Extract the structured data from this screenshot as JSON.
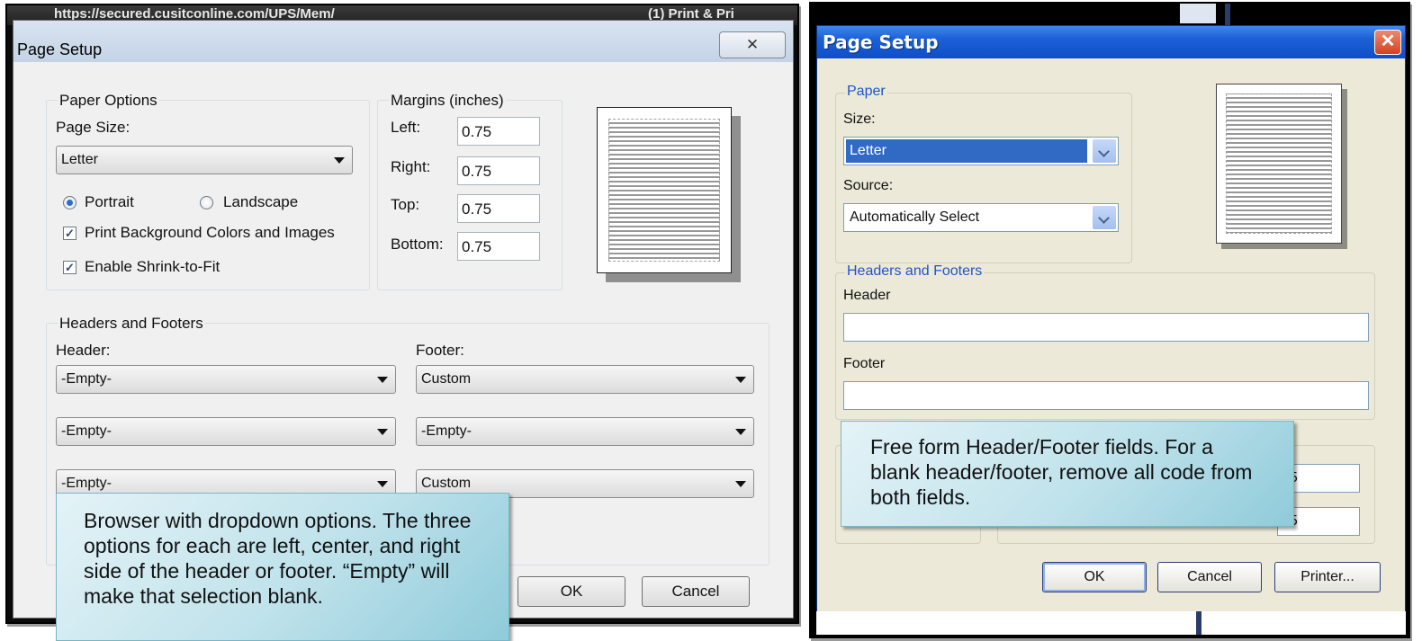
{
  "left_dialog": {
    "browser_strip_text": "https://secured.cusitconline.com/UPS/Mem/",
    "browser_strip_tail": "(1) Print & Pri",
    "title": "Page Setup",
    "close_glyph": "✕",
    "paper_options": {
      "legend": "Paper Options",
      "page_size_label": "Page Size:",
      "page_size_value": "Letter",
      "portrait_label": "Portrait",
      "portrait_selected": true,
      "landscape_label": "Landscape",
      "print_background_label": "Print Background Colors and Images",
      "print_background_checked": true,
      "shrink_label": "Enable Shrink-to-Fit",
      "shrink_checked": true
    },
    "margins": {
      "legend": "Margins (inches)",
      "left_label": "Left:",
      "left_value": "0.75",
      "right_label": "Right:",
      "right_value": "0.75",
      "top_label": "Top:",
      "top_value": "0.75",
      "bottom_label": "Bottom:",
      "bottom_value": "0.75"
    },
    "headers_footers": {
      "legend": "Headers and Footers",
      "header_label": "Header:",
      "footer_label": "Footer:",
      "header_values": [
        "-Empty-",
        "-Empty-",
        "-Empty-"
      ],
      "footer_values": [
        "Custom",
        "-Empty-",
        "Custom"
      ]
    },
    "ok_label": "OK",
    "cancel_label": "Cancel",
    "callout": "Browser with dropdown options.  The three options for each are left, center, and right side of the header or footer.  “Empty” will make that selection blank."
  },
  "right_dialog": {
    "title": "Page Setup",
    "close_glyph": "✕",
    "paper": {
      "legend": "Paper",
      "size_label": "Size:",
      "size_value": "Letter",
      "source_label": "Source:",
      "source_value": "Automatically Select"
    },
    "headers_footers": {
      "legend": "Headers and Footers",
      "header_label": "Header",
      "header_value": "",
      "footer_label": "Footer",
      "footer_value": ""
    },
    "hidden_margin_values": [
      "75",
      "75"
    ],
    "ok_label": "OK",
    "cancel_label": "Cancel",
    "printer_label": "Printer...",
    "callout": "Free form Header/Footer fields.  For a blank header/footer, remove all code from both fields."
  }
}
